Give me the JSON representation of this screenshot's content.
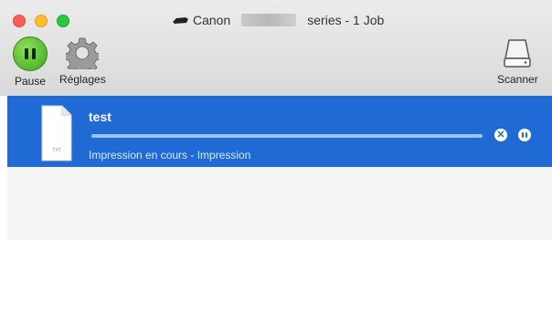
{
  "window": {
    "title_prefix": "Canon",
    "title_suffix": "series - 1 Job"
  },
  "toolbar": {
    "pause_label": "Pause",
    "settings_label": "Réglages",
    "scanner_label": "Scanner"
  },
  "job": {
    "name": "test",
    "doc_badge": "TXT",
    "progress": 1.0,
    "status": "Impression en cours - Impression"
  },
  "colors": {
    "selection": "#1f6ad4",
    "pause_green": "#3aa61a"
  },
  "icons": [
    "printer-icon",
    "pause-icon",
    "gear-icon",
    "scanner-icon",
    "document-icon",
    "cancel-icon"
  ]
}
